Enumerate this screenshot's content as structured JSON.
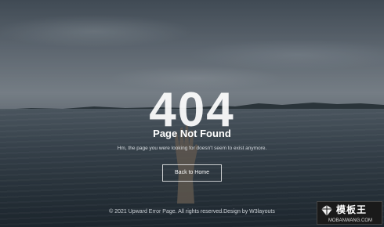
{
  "error": {
    "code": "404",
    "title": "Page Not Found",
    "message": "Hm, the page you were looking for doesn't seem to exist anymore.",
    "button_label": "Back to Home"
  },
  "footer": {
    "text": "© 2021 Upward Error Page. All rights reserved.Design by W3layouts"
  },
  "watermark": {
    "title": "模板王",
    "url": "MOBANWANG.COM"
  }
}
